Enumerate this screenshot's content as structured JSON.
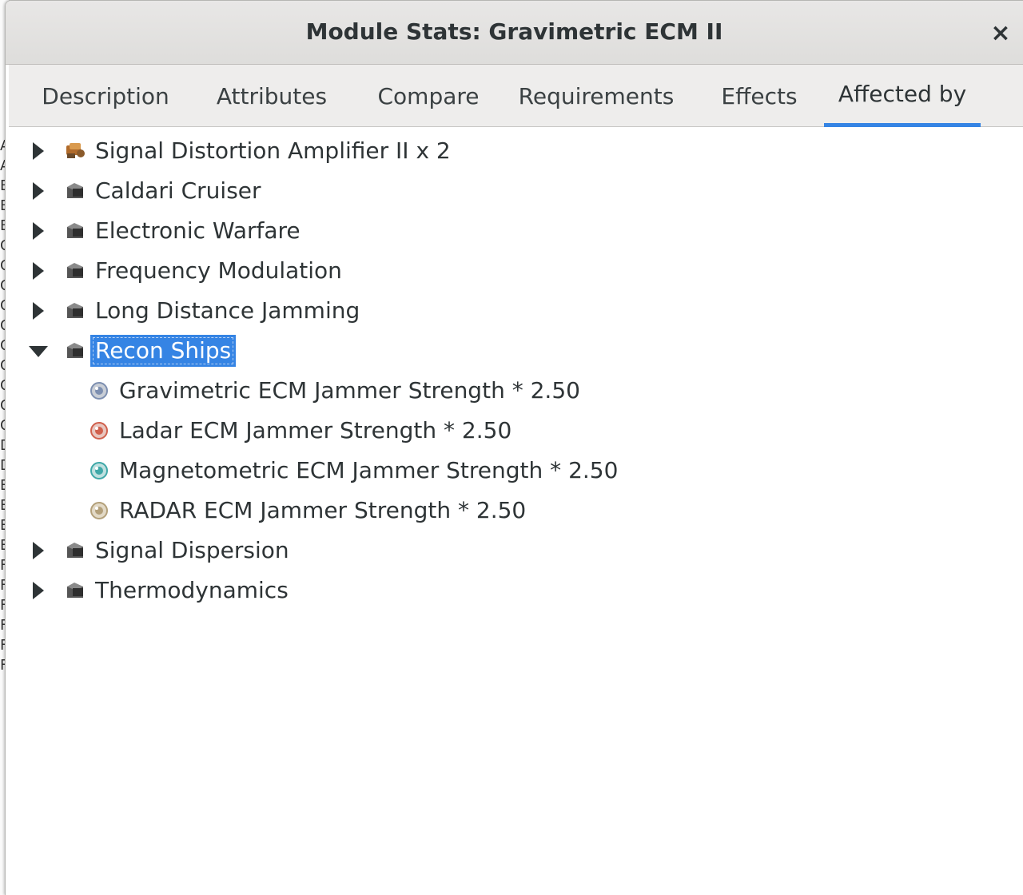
{
  "window": {
    "title": "Module Stats: Gravimetric ECM II",
    "close_label": "×"
  },
  "tabs": [
    {
      "label": "Description",
      "active": false
    },
    {
      "label": "Attributes",
      "active": false
    },
    {
      "label": "Compare",
      "active": false
    },
    {
      "label": "Requirements",
      "active": false
    },
    {
      "label": "Effects",
      "active": false
    },
    {
      "label": "Affected by",
      "active": true
    }
  ],
  "tree": {
    "items": [
      {
        "label": "Signal Distortion Amplifier II x 2",
        "icon": "module-icon",
        "expanded": false
      },
      {
        "label": "Caldari Cruiser",
        "icon": "skill-book-icon",
        "expanded": false
      },
      {
        "label": "Electronic Warfare",
        "icon": "skill-book-icon",
        "expanded": false
      },
      {
        "label": "Frequency Modulation",
        "icon": "skill-book-icon",
        "expanded": false
      },
      {
        "label": "Long Distance Jamming",
        "icon": "skill-book-icon",
        "expanded": false
      },
      {
        "label": "Recon Ships",
        "icon": "skill-book-icon",
        "expanded": true,
        "selected": true,
        "children": [
          {
            "label": "Gravimetric ECM Jammer Strength * 2.50",
            "icon": "gravimetric-sensor-icon",
            "color": "#7d8fb0"
          },
          {
            "label": "Ladar ECM Jammer Strength * 2.50",
            "icon": "ladar-sensor-icon",
            "color": "#d0604d"
          },
          {
            "label": "Magnetometric ECM Jammer Strength * 2.50",
            "icon": "magnetometric-sensor-icon",
            "color": "#3fa8a8"
          },
          {
            "label": "RADAR ECM Jammer Strength * 2.50",
            "icon": "radar-sensor-icon",
            "color": "#b3a07a"
          }
        ]
      },
      {
        "label": "Signal Dispersion",
        "icon": "skill-book-icon",
        "expanded": false
      },
      {
        "label": "Thermodynamics",
        "icon": "skill-book-icon",
        "expanded": false
      }
    ]
  },
  "background_window": {
    "edge_letters": [
      "A",
      "A",
      "B",
      "B",
      "B",
      "C",
      "C",
      "C",
      "C",
      "C",
      "C",
      "C",
      "C",
      "C",
      "C",
      "D",
      "D",
      "E",
      "E",
      "E",
      "E",
      "F",
      "F",
      "F",
      "F",
      "F",
      "F"
    ]
  },
  "colors": {
    "accent": "#3584e4",
    "text": "#2e3436"
  }
}
